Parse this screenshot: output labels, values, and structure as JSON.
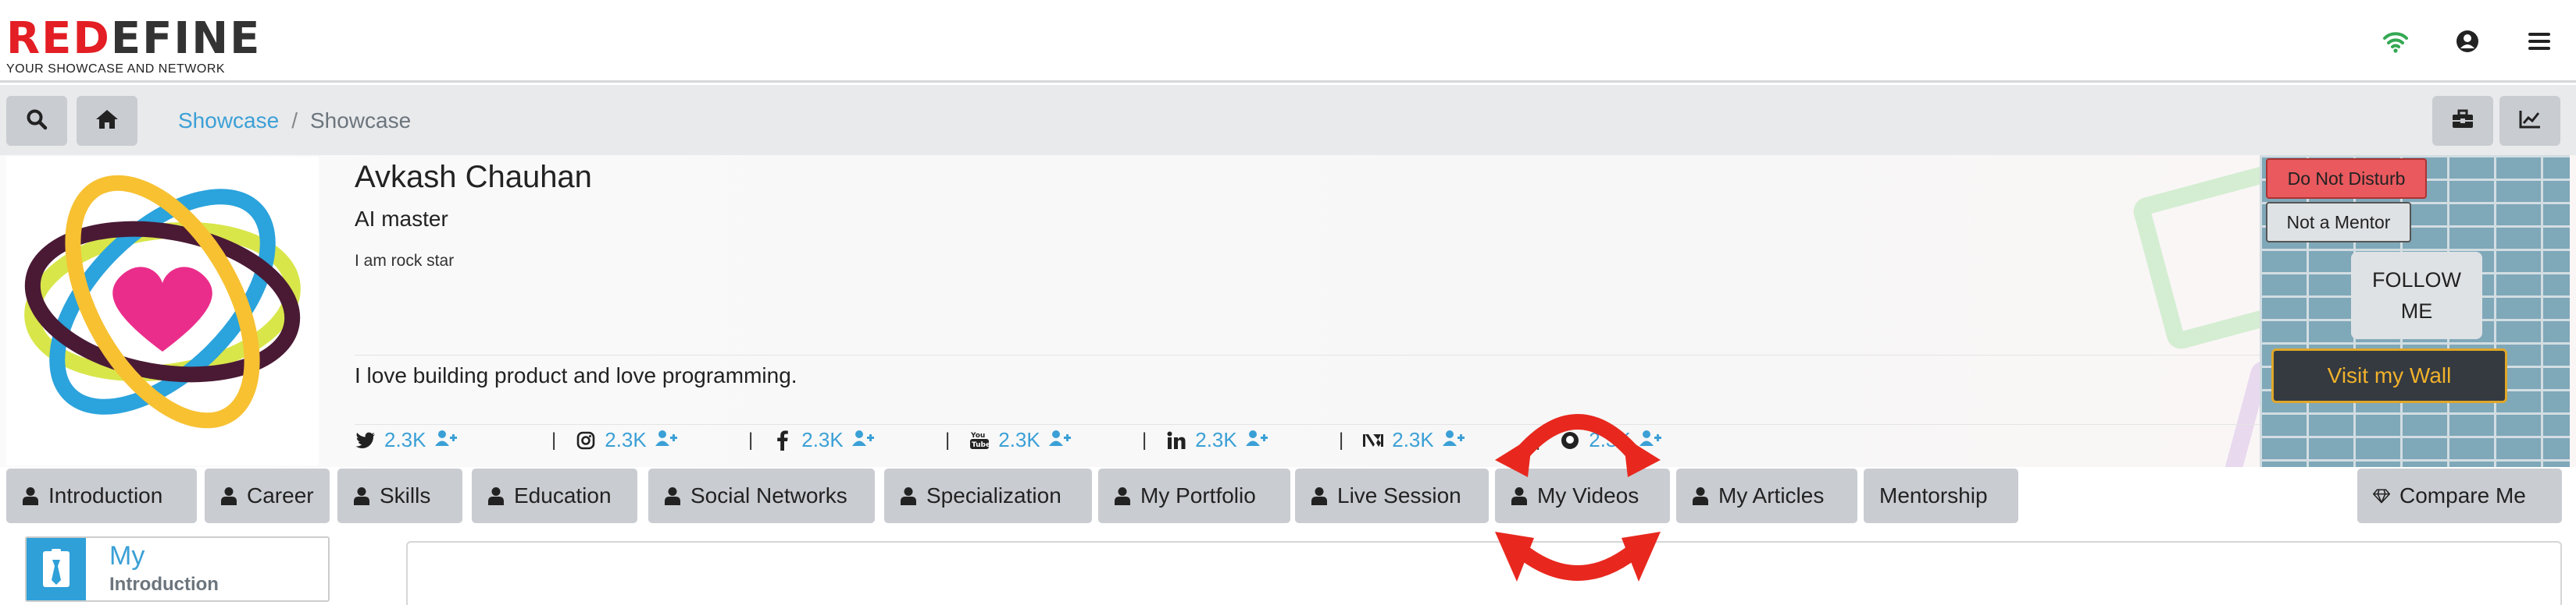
{
  "brand": {
    "name_red": "RED",
    "name_dark": "EFINE",
    "tagline": "YOUR SHOWCASE AND NETWORK"
  },
  "topbar": {
    "icons": [
      "wifi-icon",
      "user-circle-icon",
      "hamburger-menu-icon"
    ],
    "wifi_color": "#34a853"
  },
  "breadcrumb": {
    "items": [
      "Showcase",
      "Showcase"
    ],
    "separator": "/"
  },
  "profile": {
    "name": "Avkash Chauhan",
    "title": "AI master",
    "bio": "I am rock star",
    "description": "I love building product and love programming.",
    "social": [
      {
        "icon": "twitter-icon",
        "count": "2.3K"
      },
      {
        "icon": "instagram-icon",
        "count": "2.3K"
      },
      {
        "icon": "facebook-icon",
        "count": "2.3K"
      },
      {
        "icon": "youtube-icon",
        "count": "2.3K"
      },
      {
        "icon": "linkedin-icon",
        "count": "2.3K"
      },
      {
        "icon": "medium-icon",
        "count": "2.3K"
      },
      {
        "icon": "github-icon",
        "count": "2.3K"
      }
    ],
    "buttons": {
      "dnd": "Do Not Disturb",
      "mentor": "Not a Mentor",
      "follow_1": "FOLLOW",
      "follow_2": "ME",
      "wall": "Visit my Wall"
    }
  },
  "tabs": [
    "Introduction",
    "Career",
    "Skills",
    "Education",
    "Social Networks",
    "Specialization",
    "My Portfolio",
    "Live Session",
    "My Videos",
    "My Articles",
    "Mentorship"
  ],
  "compare": "Compare Me",
  "intro_card": {
    "title": "My",
    "subtitle": "Introduction"
  },
  "colors": {
    "accent": "#3ba0d6",
    "brand_red": "#e31e24",
    "dnd_red": "#e9595e",
    "wall_gold": "#f0b12b",
    "tab_gray": "#c9ccd1",
    "annotation_red": "#e8281e"
  }
}
